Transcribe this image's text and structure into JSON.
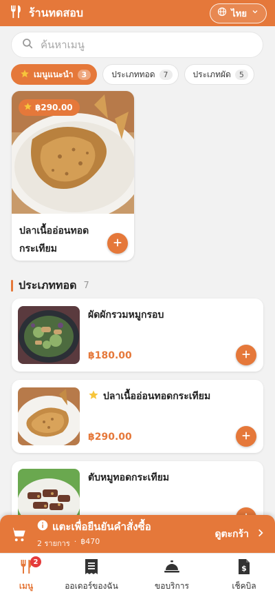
{
  "header": {
    "title": "ร้านทดสอบ",
    "language_label": "ไทย"
  },
  "search": {
    "placeholder": "ค้นหาเมนู",
    "value": ""
  },
  "categories": [
    {
      "label": "เมนูแนะนำ",
      "count": "3",
      "active": true
    },
    {
      "label": "ประเภททอด",
      "count": "7",
      "active": false
    },
    {
      "label": "ประเภทผัด",
      "count": "5",
      "active": false
    }
  ],
  "recommended": [
    {
      "name": "ปลาเนื้ออ่อนทอดกระเทียม",
      "price": "฿290.00"
    }
  ],
  "section": {
    "title": "ประเภททอด",
    "count": "7"
  },
  "items": [
    {
      "name": "ผัดผักรวมหมูกรอบ",
      "price": "฿180.00",
      "recommended": false
    },
    {
      "name": "ปลาเนื้ออ่อนทอดกระเทียม",
      "price": "฿290.00",
      "recommended": true
    },
    {
      "name": "ตับหมูทอดกระเทียม",
      "price": "",
      "recommended": false
    }
  ],
  "cart": {
    "title": "แตะเพื่อยืนยันคำสั่งซื้อ",
    "item_count": "2 รายการ",
    "separator": "·",
    "total": "฿470",
    "view_label": "ดูตะกร้า"
  },
  "bottom_nav": [
    {
      "label": "เมนู",
      "icon": "fork-knife-icon",
      "badge": "2",
      "active": true
    },
    {
      "label": "ออเดอร์ของฉัน",
      "icon": "receipt-icon",
      "badge": "",
      "active": false
    },
    {
      "label": "ขอบริการ",
      "icon": "service-bell-icon",
      "badge": "",
      "active": false
    },
    {
      "label": "เช็คบิล",
      "icon": "bill-icon",
      "badge": "",
      "active": false
    }
  ],
  "colors": {
    "accent": "#e5783a",
    "background": "#f2f2f2",
    "badge_red": "#e53b3b"
  }
}
